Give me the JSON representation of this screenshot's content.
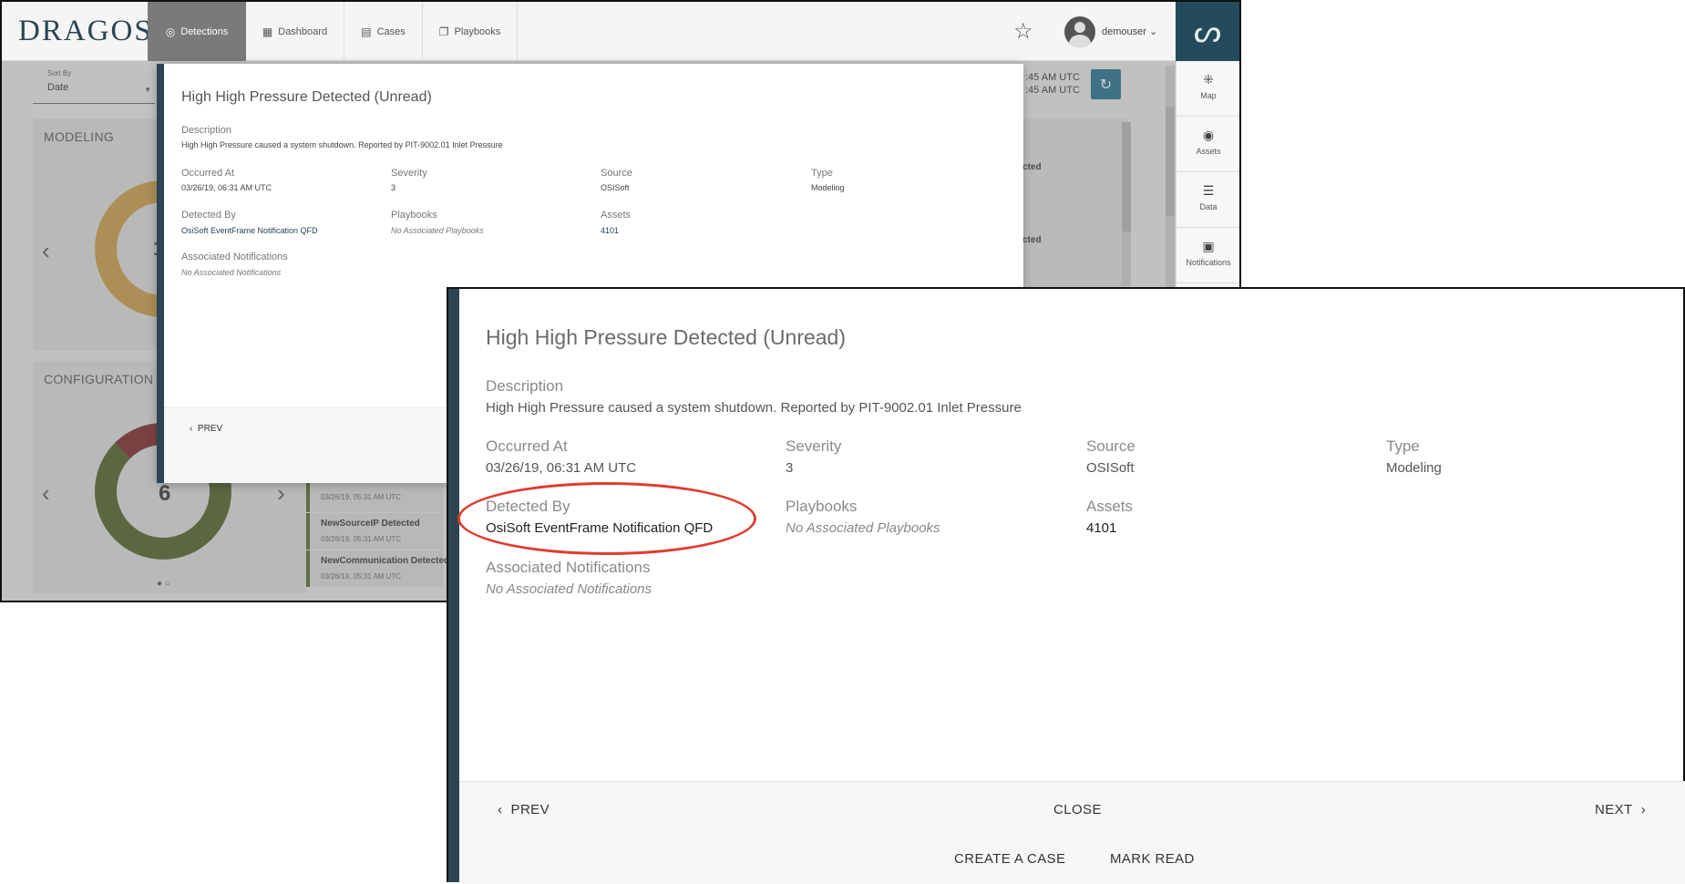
{
  "app": {
    "logo": "DRAGOS",
    "nav": [
      {
        "label": "Detections",
        "icon": "fingerprint-icon"
      },
      {
        "label": "Dashboard",
        "icon": "dashboard-icon"
      },
      {
        "label": "Cases",
        "icon": "clipboard-icon"
      },
      {
        "label": "Playbooks",
        "icon": "book-icon"
      }
    ],
    "username": "demouser",
    "brand_glyph": "ᔕ",
    "rail": [
      {
        "label": "Map",
        "icon": "map-icon"
      },
      {
        "label": "Assets",
        "icon": "compass-icon"
      },
      {
        "label": "Data",
        "icon": "database-icon"
      },
      {
        "label": "Notifications",
        "icon": "archive-icon"
      }
    ],
    "sort": {
      "label": "Sort By",
      "value": "Date"
    },
    "timestamps": [
      ":45 AM UTC",
      ":45 AM UTC"
    ],
    "cards": [
      {
        "title": "MODELING",
        "count": "1",
        "color": "#c99a45"
      },
      {
        "title": "CONFIGURATION",
        "count": "6",
        "color": "#4a5e22"
      }
    ],
    "list_items": [
      {
        "title": "NewCommunication Detected",
        "date": "03/26/19, 05:31 AM UTC"
      },
      {
        "title": "NewSourceIP Detected",
        "date": "03/26/19, 05:31 AM UTC"
      },
      {
        "title": "NewCommunication Detected",
        "date": "03/26/19, 05:31 AM UTC"
      }
    ],
    "stubs": [
      "cted",
      "cted"
    ]
  },
  "detection": {
    "title": "High High Pressure Detected (Unread)",
    "description_label": "Description",
    "description": "High High Pressure caused a system shutdown. Reported by PIT-9002.01 Inlet Pressure",
    "occurred_label": "Occurred At",
    "occurred": "03/26/19, 06:31 AM UTC",
    "severity_label": "Severity",
    "severity": "3",
    "source_label": "Source",
    "source": "OSISoft",
    "type_label": "Type",
    "type": "Modeling",
    "detected_by_label": "Detected By",
    "detected_by": "OsiSoft EventFrame Notification QFD",
    "playbooks_label": "Playbooks",
    "playbooks": "No Associated Playbooks",
    "assets_label": "Assets",
    "assets": "4101",
    "notifications_label": "Associated Notifications",
    "notifications": "No Associated Notifications"
  },
  "footer": {
    "prev": "PREV",
    "close": "CLOSE",
    "next": "NEXT",
    "create_case": "CREATE A CASE",
    "mark_read": "MARK READ"
  },
  "colors": {
    "accent": "#2b4652",
    "highlight": "#e03b2e",
    "refresh": "#1d6f8a"
  }
}
